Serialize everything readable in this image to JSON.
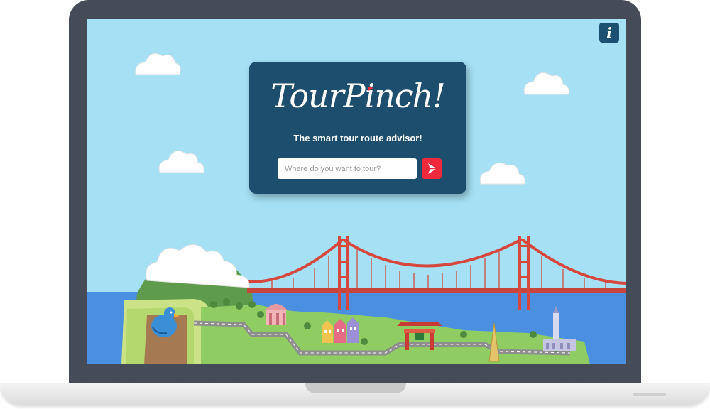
{
  "app": {
    "logo_text": "TourPinch!",
    "tagline": "The smart tour route advisor!"
  },
  "search": {
    "placeholder": "Where do you want to tour?",
    "value": ""
  },
  "icons": {
    "info": "info-icon",
    "go": "send-arrow-icon"
  },
  "colors": {
    "sky": "#a5e0f4",
    "card": "#1d4e6d",
    "accent": "#ee2a3c",
    "bridge": "#d6483e",
    "water": "#4a8fe0",
    "land": "#8fcd62"
  }
}
